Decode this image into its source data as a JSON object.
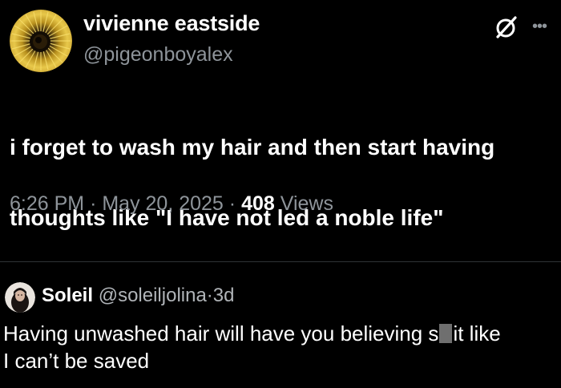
{
  "post": {
    "display_name": "vivienne eastside",
    "handle": "@pigeonboyalex",
    "text_line1": "i forget to wash my hair and then start having",
    "text_line2": "thoughts like \"I have not led a noble life\"",
    "time": "6:26 PM",
    "date": "May 20, 2025",
    "separator": "·",
    "views_count": "408",
    "views_label": "Views",
    "grok_icon": "grok-icon",
    "more_icon": "more-horizontal-icon"
  },
  "reply": {
    "display_name": "Soleil",
    "handle": "@soleiljolina",
    "separator": "·",
    "age": "3d",
    "text_before_censor": "Having unwashed hair will have you believing s",
    "text_after_censor": "it like",
    "text_line2": "I can’t be saved"
  },
  "colors": {
    "background": "#000000",
    "text": "#ffffff",
    "secondary_text": "#8e949a",
    "divider": "#2f3336"
  }
}
